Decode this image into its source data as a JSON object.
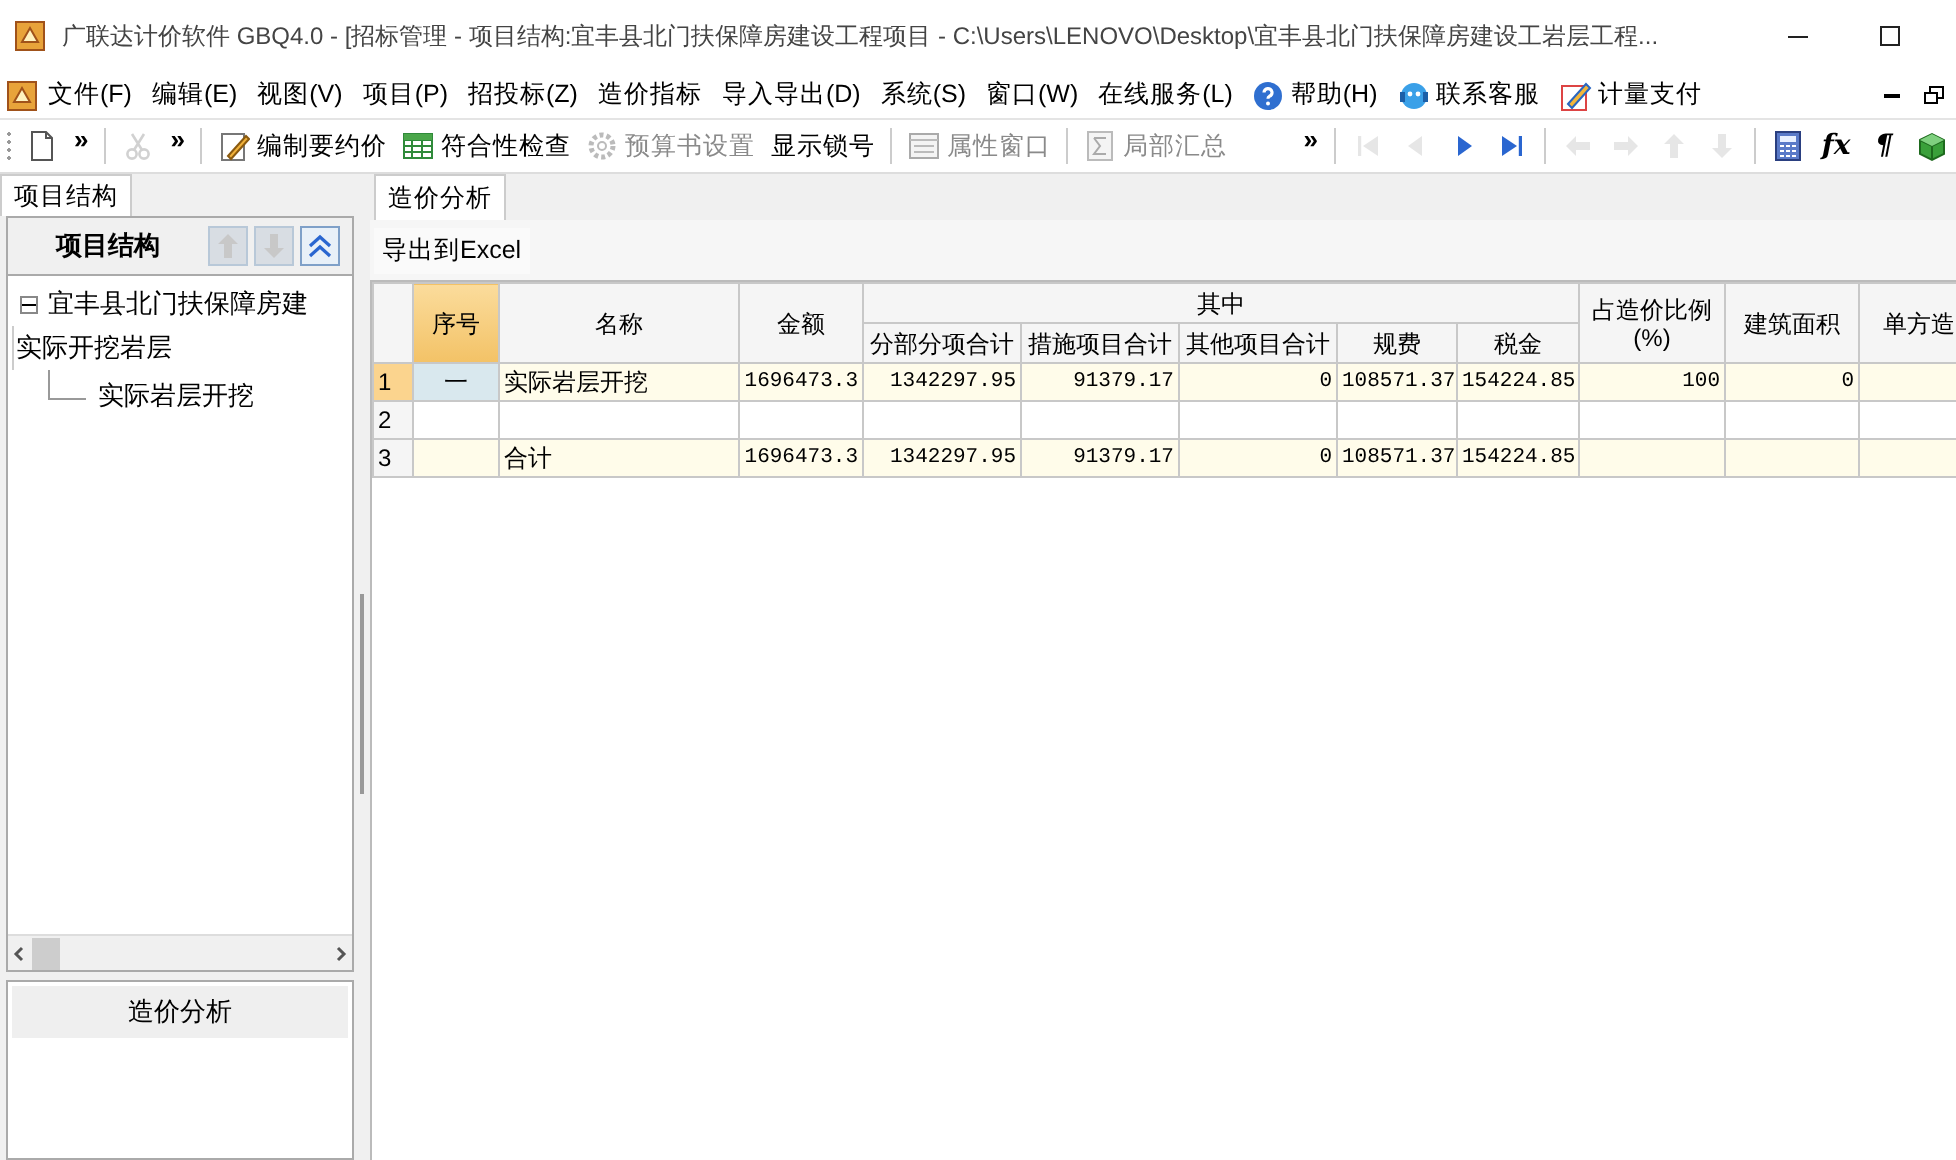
{
  "window": {
    "title": "广联达计价软件 GBQ4.0 - [招标管理 - 项目结构:宜丰县北门扶保障房建设工程项目 - C:\\Users\\LENOVO\\Desktop\\宜丰县北门扶保障房建设工岩层工程..."
  },
  "menu": [
    {
      "label": "文件(F)",
      "kind": "plain"
    },
    {
      "label": "编辑(E)",
      "kind": "plain"
    },
    {
      "label": "视图(V)",
      "kind": "plain"
    },
    {
      "label": "项目(P)",
      "kind": "plain"
    },
    {
      "label": "招投标(Z)",
      "kind": "plain"
    },
    {
      "label": "造价指标",
      "kind": "plain"
    },
    {
      "label": "导入导出(D)",
      "kind": "plain"
    },
    {
      "label": "系统(S)",
      "kind": "plain"
    },
    {
      "label": "窗口(W)",
      "kind": "plain"
    },
    {
      "label": "在线服务(L)",
      "kind": "plain"
    },
    {
      "label": "帮助(H)",
      "kind": "help"
    },
    {
      "label": "联系客服",
      "kind": "contact"
    },
    {
      "label": "计量支付",
      "kind": "pay"
    }
  ],
  "toolbar": {
    "left": [
      {
        "kind": "new",
        "disabled": false
      },
      {
        "kind": "overflow",
        "label": "»"
      },
      {
        "kind": "sep"
      },
      {
        "kind": "cut",
        "disabled": true
      },
      {
        "kind": "overflow",
        "label": "»"
      },
      {
        "kind": "sep"
      },
      {
        "kind": "edit",
        "label": "编制要约价",
        "disabled": false
      },
      {
        "kind": "check",
        "label": "符合性检查",
        "disabled": false
      },
      {
        "kind": "gear",
        "label": "预算书设置",
        "disabled": true
      },
      {
        "kind": "text",
        "label": "显示锁号",
        "disabled": false
      },
      {
        "kind": "sep"
      },
      {
        "kind": "window",
        "label": "属性窗口",
        "disabled": true
      },
      {
        "kind": "sep"
      },
      {
        "kind": "sum",
        "label": "局部汇总",
        "disabled": true
      }
    ],
    "right": [
      {
        "kind": "overflow",
        "label": "»"
      },
      {
        "kind": "sep"
      },
      {
        "kind": "first",
        "disabled": true
      },
      {
        "kind": "prev",
        "disabled": true
      },
      {
        "kind": "next",
        "disabled": false
      },
      {
        "kind": "last",
        "disabled": false
      },
      {
        "kind": "sep"
      },
      {
        "kind": "left",
        "disabled": true
      },
      {
        "kind": "right",
        "disabled": true
      },
      {
        "kind": "up",
        "disabled": true
      },
      {
        "kind": "down",
        "disabled": true
      },
      {
        "kind": "sep"
      },
      {
        "kind": "calc",
        "disabled": false
      },
      {
        "kind": "glyph",
        "label": "fx",
        "disabled": false
      },
      {
        "kind": "glyph",
        "label": "¶",
        "disabled": false
      },
      {
        "kind": "cube",
        "disabled": false
      }
    ]
  },
  "left_panel": {
    "tabs": [
      {
        "label": "项目结构",
        "selected": true
      }
    ],
    "header": {
      "title": "项目结构",
      "buttons": [
        {
          "kind": "up",
          "disabled": true
        },
        {
          "kind": "down",
          "disabled": true
        },
        {
          "kind": "collapse",
          "disabled": false
        }
      ]
    },
    "tree": [
      {
        "label_lines": [
          "宜丰县北门扶保障房建",
          "实际开挖岩层"
        ],
        "expanded": true,
        "children": [
          {
            "label": "实际岩层开挖"
          }
        ]
      }
    ],
    "nav_items": [
      {
        "label": "造价分析"
      }
    ]
  },
  "main": {
    "tabs": [
      {
        "label": "造价分析",
        "selected": true
      }
    ],
    "export_button": "导出到Excel",
    "table": {
      "columns": [
        {
          "label": "序号",
          "kind": "code",
          "selected": true
        },
        {
          "label": "名称",
          "kind": "text",
          "selected": false
        },
        {
          "label": "金额",
          "kind": "number",
          "selected": false
        },
        {
          "label": "其中",
          "colspan": 5,
          "children": [
            {
              "label": "分部分项合计",
              "kind": "number",
              "selected": false
            },
            {
              "label": "措施项目合计",
              "kind": "number",
              "selected": false
            },
            {
              "label": "其他项目合计",
              "kind": "number",
              "selected": false
            },
            {
              "label": "规费",
              "kind": "number",
              "selected": false
            },
            {
              "label": "税金",
              "kind": "number",
              "selected": false
            }
          ]
        },
        {
          "label": "占造价比例(%)",
          "kind": "number",
          "selected": false
        },
        {
          "label": "建筑面积",
          "kind": "number",
          "selected": false
        },
        {
          "label": "单方造",
          "kind": "number",
          "selected": false
        }
      ],
      "rows": [
        {
          "number": "1",
          "kind": "item",
          "selected": true,
          "cells": [
            "一",
            "实际岩层开挖",
            "1696473.3",
            "1342297.95",
            "91379.17",
            "0",
            "108571.37",
            "154224.85",
            "100",
            "0",
            ""
          ]
        },
        {
          "number": "2",
          "kind": "blank",
          "selected": false,
          "cells": [
            "",
            "",
            "",
            "",
            "",
            "",
            "",
            "",
            "",
            "",
            ""
          ]
        },
        {
          "number": "3",
          "kind": "total",
          "selected": false,
          "cells": [
            "",
            "合计",
            "1696473.3",
            "1342297.95",
            "91379.17",
            "0",
            "108571.37",
            "154224.85",
            "",
            "",
            ""
          ]
        }
      ]
    }
  }
}
